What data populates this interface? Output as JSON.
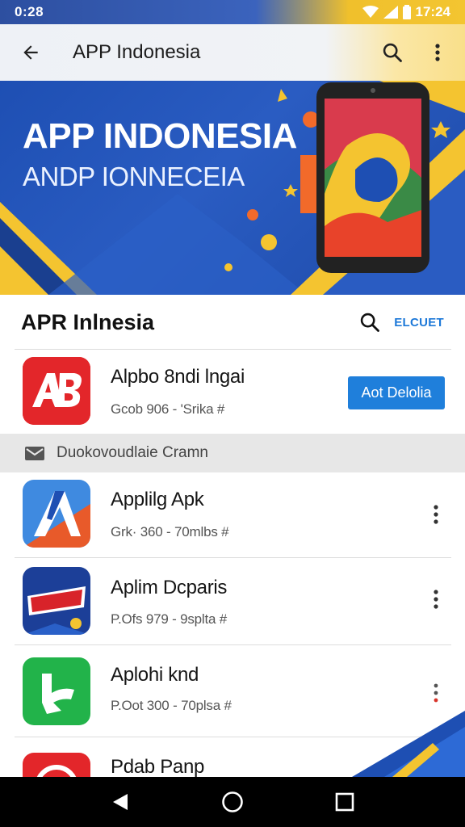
{
  "status_bar": {
    "time": "0:28",
    "clock_right": "17:24",
    "icons": [
      "wifi-icon",
      "signal-icon",
      "battery-icon"
    ]
  },
  "app_bar": {
    "title": "APP Indonesia",
    "icons": [
      "back-arrow-icon",
      "search-icon",
      "more-vert-icon"
    ]
  },
  "banner": {
    "title": "APP INDONESIA",
    "subtitle": "ANDP IONNECEIA"
  },
  "section": {
    "title": "APR Inlnesia",
    "link_label": "ELCUET"
  },
  "featured": {
    "name": "Alpbo 8ndi lngai",
    "meta": "Gcob 906 - 'Srika #",
    "install_label": "Aot Delolia"
  },
  "category": {
    "label": "Duokovoudlaie Cramn"
  },
  "apps": [
    {
      "name": "Applilg Apk",
      "meta": "Grk· 360 - 70mlbs #"
    },
    {
      "name": "Aplim Dcparis",
      "meta": "P.Ofs 979 - 9splta #"
    },
    {
      "name": "Aplohi knd",
      "meta": "P.Oot 300 - 70plsa #"
    },
    {
      "name": "Pdab Panp",
      "meta": ""
    }
  ],
  "colors": {
    "accent": "#1f7fdb",
    "banner_blue": "#1e4fb3",
    "banner_yellow": "#f4c430",
    "nav_bg": "#000000"
  }
}
